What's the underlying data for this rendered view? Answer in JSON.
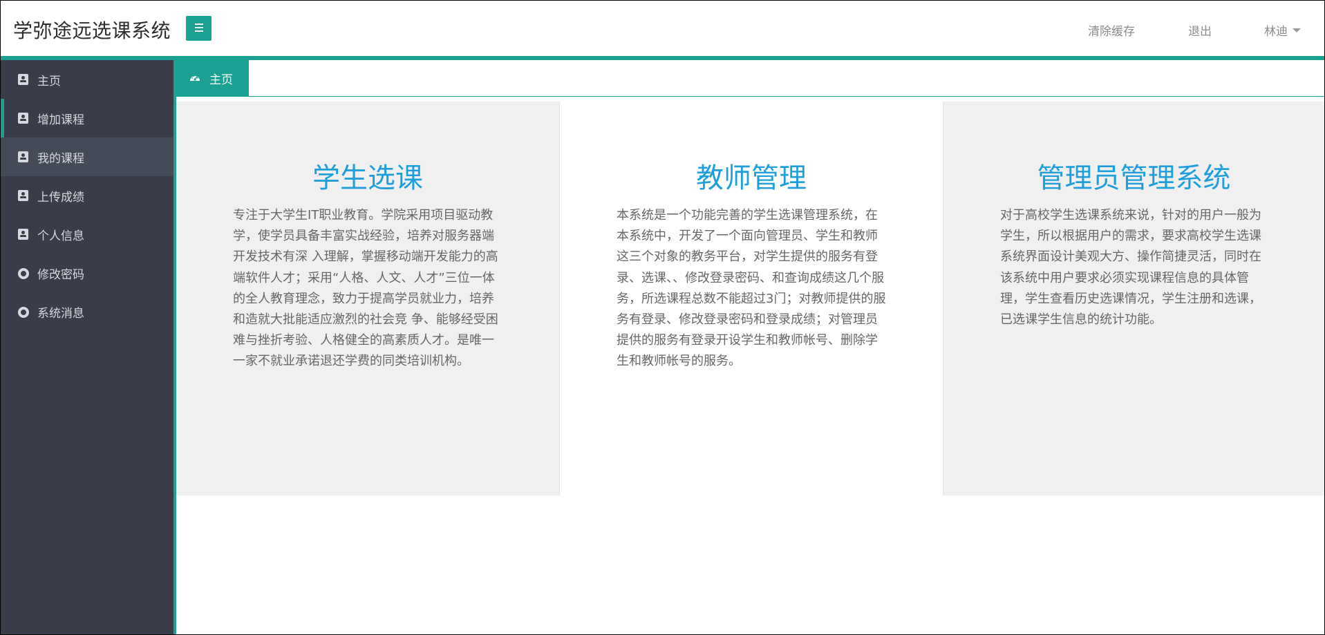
{
  "header": {
    "app_title": "学弥途远选课系统",
    "clear_cache": "清除缓存",
    "logout": "退出",
    "user_name": "林迪",
    "accent_color": "#1aa194"
  },
  "sidebar": {
    "items": [
      {
        "label": "主页",
        "icon": "contact-card-icon"
      },
      {
        "label": "增加课程",
        "icon": "contact-card-icon"
      },
      {
        "label": "我的课程",
        "icon": "contact-card-icon"
      },
      {
        "label": "上传成绩",
        "icon": "contact-card-icon"
      },
      {
        "label": "个人信息",
        "icon": "contact-card-icon"
      },
      {
        "label": "修改密码",
        "icon": "circle-icon"
      },
      {
        "label": "系统消息",
        "icon": "circle-icon"
      }
    ]
  },
  "tabs": {
    "active_label": "主页",
    "active_icon": "dashboard-icon"
  },
  "panels": [
    {
      "title": "学生选课",
      "text": "专注于大学生IT职业教育。学院采用项目驱动教学，使学员具备丰富实战经验，培养对服务器端开发技术有深 入理解，掌握移动端开发能力的高端软件人才；采用“人格、人文、人才”三位一体的全人教育理念，致力于提高学员就业力，培养和造就大批能适应激烈的社会竞 争、能够经受困难与挫折考验、人格健全的高素质人才。是唯一一家不就业承诺退还学费的同类培训机构。"
    },
    {
      "title": "教师管理",
      "text": "本系统是一个功能完善的学生选课管理系统，在本系统中，开发了一个面向管理员、学生和教师这三个对象的教务平台，对学生提供的服务有登录、选课、、修改登录密码、和查询成绩这几个服务，所选课程总数不能超过3门；对教师提供的服务有登录、修改登录密码和登录成绩；对管理员提供的服务有登录开设学生和教师帐号、删除学生和教师帐号的服务。"
    },
    {
      "title": "管理员管理系统",
      "text": "对于高校学生选课系统来说，针对的用户一般为学生，所以根据用户的需求，要求高校学生选课系统界面设计美观大方、操作简捷灵活，同时在该系统中用户要求必须实现课程信息的具体管理，学生查看历史选课情况，学生注册和选课，已选课学生信息的统计功能。"
    }
  ]
}
